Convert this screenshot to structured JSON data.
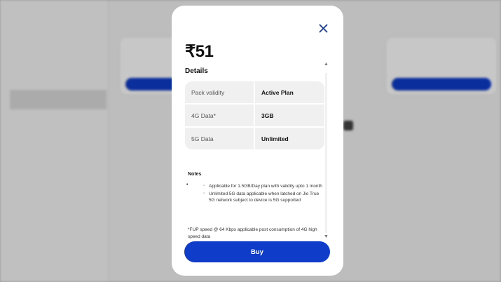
{
  "modal": {
    "price": "₹51",
    "details_title": "Details",
    "rows": [
      {
        "label": "Pack validity",
        "value": "Active Plan"
      },
      {
        "label": "4G Data*",
        "value": "3GB"
      },
      {
        "label": "5G Data",
        "value": "Unlimited"
      }
    ],
    "notes_title": "Notes",
    "notes": [
      "Applicable for 1.5GB/Day plan with validity upto 1 month",
      "Unlimited 5G data applicable when latched on Jio True 5G network subject to device is 5G supported"
    ],
    "fup_text": "*FUP speed @ 64 Kbps applicable post consumption of 4G high speed data",
    "buy_label": "Buy",
    "icons": {
      "close": "close-icon",
      "scroll_up": "scroll-up-arrow-icon",
      "scroll_down": "scroll-down-arrow-icon"
    }
  },
  "colors": {
    "accent": "#0f3cc9",
    "cell_bg": "#f0f0f0",
    "close_icon": "#1a3c8f"
  }
}
